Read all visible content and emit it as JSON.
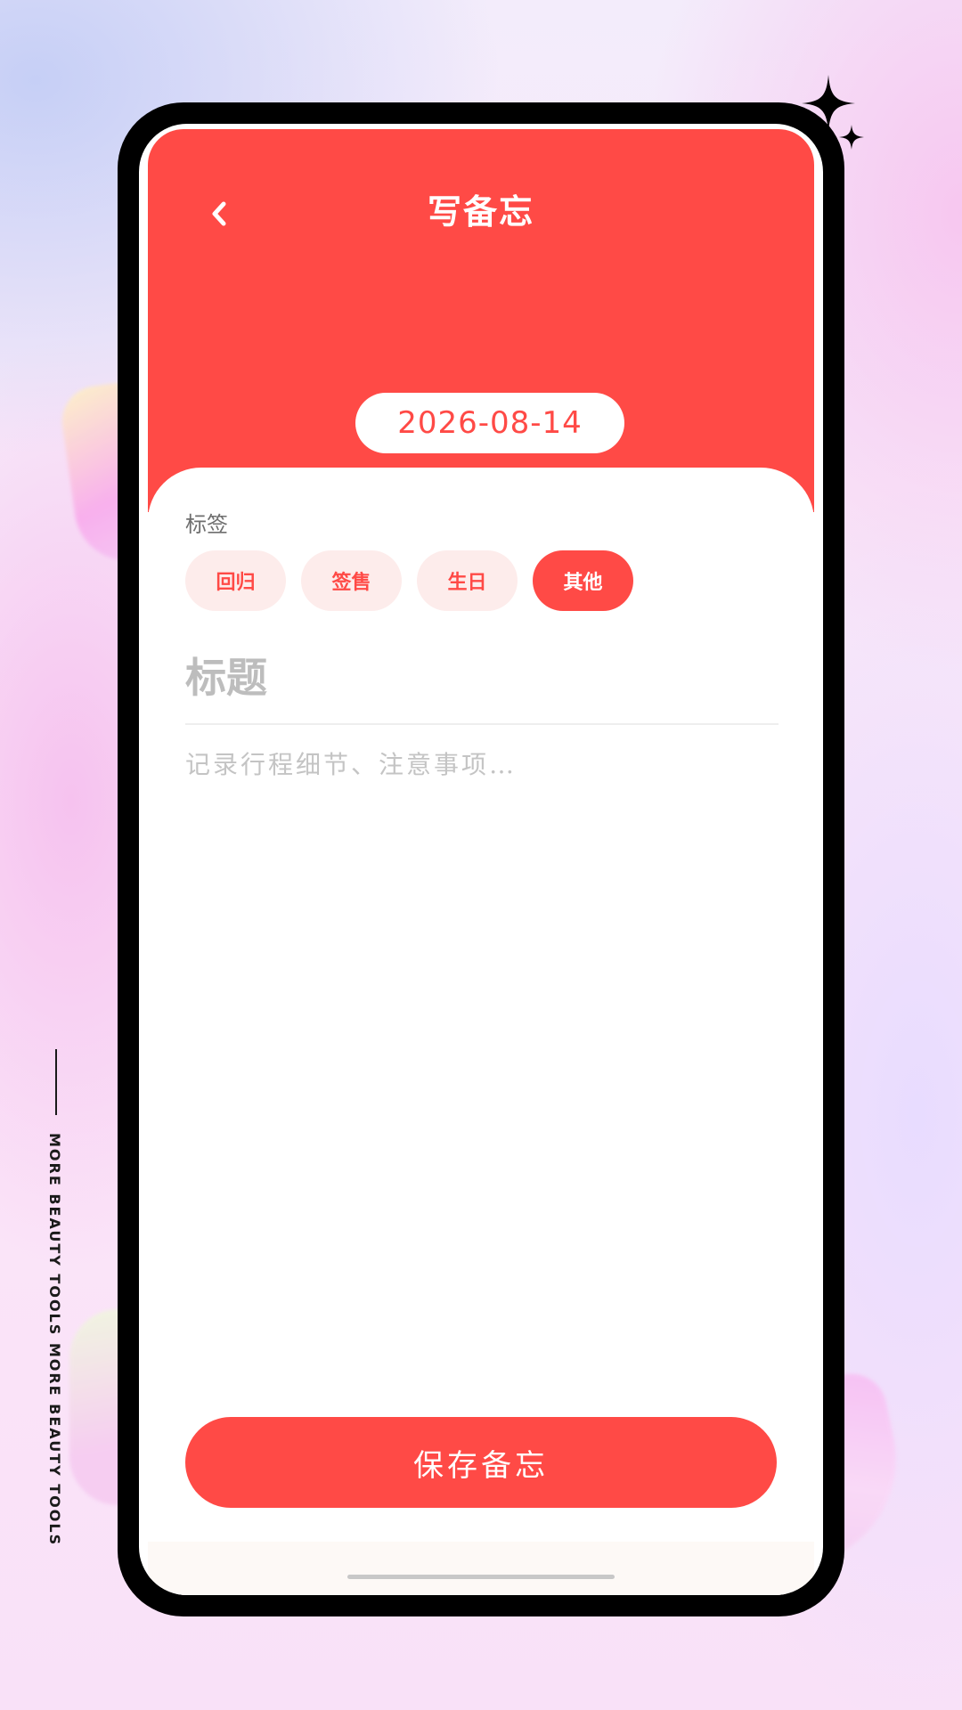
{
  "header": {
    "title": "写备忘",
    "back_icon": "chevron-left-icon",
    "background_color": "#ff4a46"
  },
  "date": {
    "value": "2026-08-14"
  },
  "tags": {
    "label": "标签",
    "items": [
      {
        "label": "回归",
        "selected": false
      },
      {
        "label": "签售",
        "selected": false
      },
      {
        "label": "生日",
        "selected": false
      },
      {
        "label": "其他",
        "selected": true
      }
    ]
  },
  "form": {
    "title_placeholder": "标题",
    "content_placeholder": "记录行程细节、注意事项…"
  },
  "save_button": {
    "label": "保存备忘"
  },
  "decor": {
    "side_text": "MORE BEAUTY TOOLS MORE BEAUTY TOOLS",
    "sparkle_icon": "sparkle-icon",
    "accent_color": "#ff4a46"
  }
}
